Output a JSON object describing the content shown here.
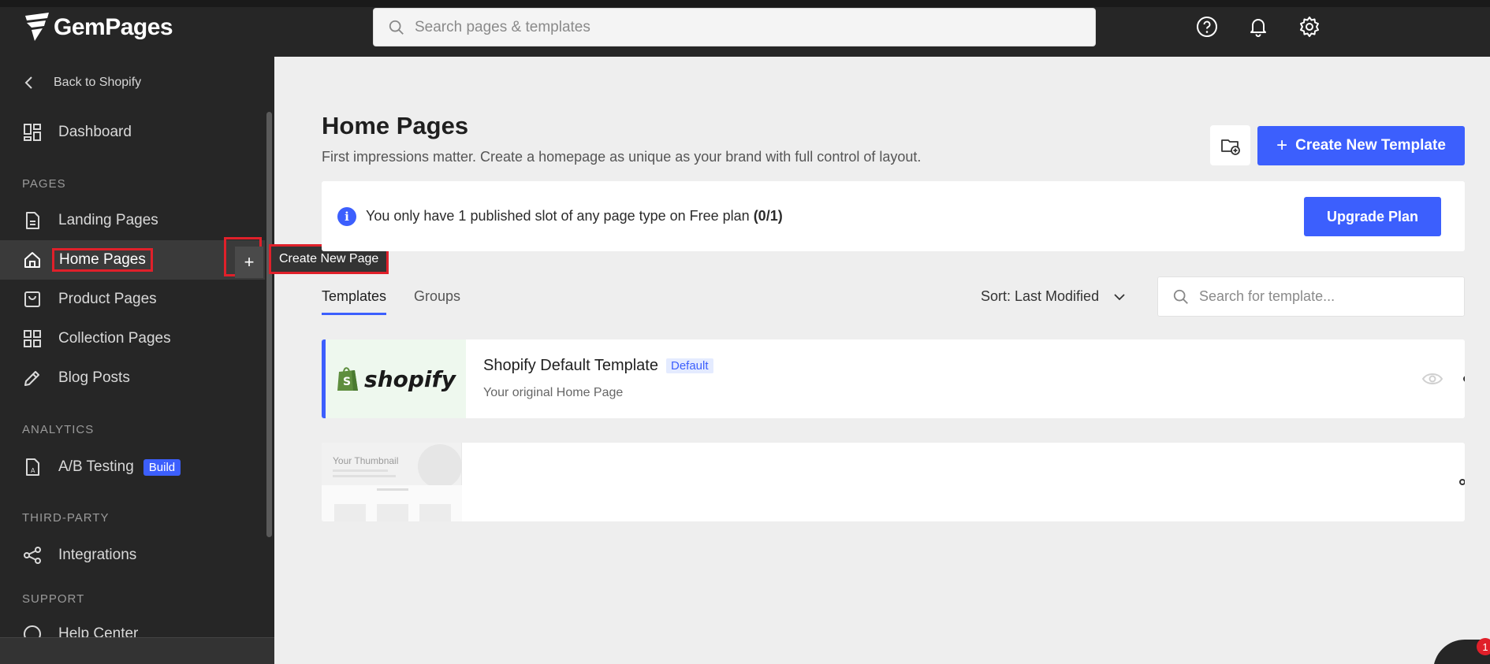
{
  "app": {
    "logo_text": "GemPages"
  },
  "topbar": {
    "search_placeholder": "Search pages & templates"
  },
  "sidebar": {
    "back_label": "Back to Shopify",
    "dashboard": "Dashboard",
    "sections": {
      "pages": "PAGES",
      "analytics": "ANALYTICS",
      "third_party": "THIRD-PARTY",
      "support": "SUPPORT"
    },
    "items": {
      "landing": "Landing Pages",
      "home": "Home Pages",
      "product": "Product Pages",
      "collection": "Collection Pages",
      "blog": "Blog Posts",
      "ab": "A/B Testing",
      "ab_badge": "Build",
      "integrations": "Integrations",
      "help": "Help Center"
    },
    "add_symbol": "+",
    "tooltip": "Create New Page"
  },
  "main": {
    "title": "Home Pages",
    "subtitle": "First impressions matter. Create a homepage as unique as your brand with full control of layout.",
    "create_button": "Create New Template",
    "notice": {
      "text": "You only have 1 published slot of any page type on Free plan ",
      "count": "(0/1)",
      "upgrade": "Upgrade Plan"
    },
    "tabs": [
      "Templates",
      "Groups"
    ],
    "sort_label": "Sort: Last Modified",
    "template_search_placeholder": "Search for template...",
    "templates": [
      {
        "name": "Shopify Default Template",
        "badge": "Default",
        "subtitle": "Your original Home Page",
        "thumb_brand": "shopify"
      },
      {
        "name": "",
        "thumb_title": "Your Thumbnail"
      }
    ]
  },
  "chat": {
    "count": "1"
  },
  "colors": {
    "accent": "#3c5ffd",
    "sidebar": "#262626",
    "highlight": "#e0202a"
  }
}
